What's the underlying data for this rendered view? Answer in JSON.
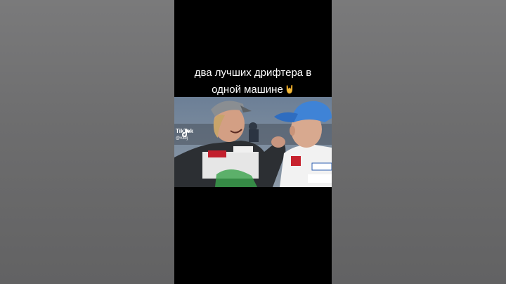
{
  "caption": {
    "line1": "два лучших дрифтера в",
    "line2": "одной машине"
  },
  "emoji": "horns-hand",
  "watermark": {
    "brand": "TikTok",
    "user": "@v3dj"
  },
  "sponsors": {
    "left_chest": "TOYO TIRES",
    "left_badge": "MOTUL",
    "right_badge": "AINO",
    "right_chest": "KYB"
  },
  "colors": {
    "background": "#6f6f70",
    "video_bg": "#000000",
    "cap_blue": "#3f83d6"
  }
}
